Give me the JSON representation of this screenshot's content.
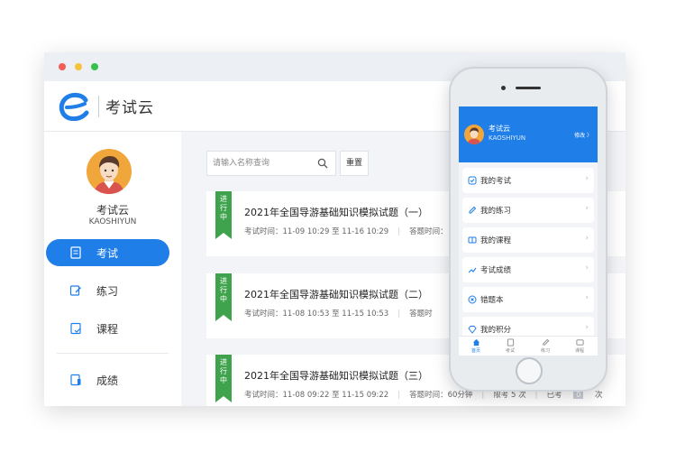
{
  "window": {
    "controls": [
      "close",
      "minimize",
      "maximize"
    ]
  },
  "header": {
    "logo_icon": "e-logo-icon",
    "app_title": "考试云"
  },
  "sidebar": {
    "user_name": "考试云",
    "user_sub": "KAOSHIYUN",
    "items": [
      {
        "label": "考试",
        "icon": "document-icon",
        "active": true
      },
      {
        "label": "练习",
        "icon": "edit-icon",
        "active": false
      },
      {
        "label": "课程",
        "icon": "course-icon",
        "active": false
      },
      {
        "label": "成绩",
        "icon": "score-icon",
        "active": false
      }
    ]
  },
  "toolbar": {
    "search_placeholder": "请输入名称查询",
    "search_value": "",
    "reset_label": "重置"
  },
  "exams": [
    {
      "status": "进行中",
      "title": "2021年全国导游基础知识模拟试题（一）",
      "time": "考试时间：11-09 10:29 至 11-16 10:29",
      "duration": "答题时间："
    },
    {
      "status": "进行中",
      "title": "2021年全国导游基础知识模拟试题（二）",
      "time": "考试时间：11-08 10:53 至 11-15 10:53",
      "duration": "答题时"
    },
    {
      "status": "进行中",
      "title": "2021年全国导游基础知识模拟试题（三）",
      "time": "考试时间：11-08 09:22 至 11-15 09:22",
      "duration": "答题时间：60分钟",
      "limit": "限考 5 次",
      "taken_prefix": "已考",
      "taken_count": "0",
      "taken_suffix": "次"
    }
  ],
  "phone": {
    "user_name": "考试云",
    "user_sub": "KAOSHIYUN",
    "edit_label": "修改 〉",
    "menu": [
      {
        "label": "我的考试",
        "icon": "exam-icon"
      },
      {
        "label": "我的练习",
        "icon": "edit-icon"
      },
      {
        "label": "我的课程",
        "icon": "course-icon"
      },
      {
        "label": "考试成绩",
        "icon": "trend-icon"
      },
      {
        "label": "错题本",
        "icon": "error-icon"
      },
      {
        "label": "我的积分",
        "icon": "points-icon"
      }
    ],
    "tabs": [
      {
        "label": "首页",
        "icon": "home-icon",
        "active": true
      },
      {
        "label": "考试",
        "icon": "exam-icon",
        "active": false
      },
      {
        "label": "练习",
        "icon": "edit-icon",
        "active": false
      },
      {
        "label": "课程",
        "icon": "course-icon",
        "active": false
      }
    ]
  },
  "colors": {
    "accent": "#1f7ee8",
    "status_green": "#3fa34d",
    "avatar_bg": "#f0a63a"
  }
}
